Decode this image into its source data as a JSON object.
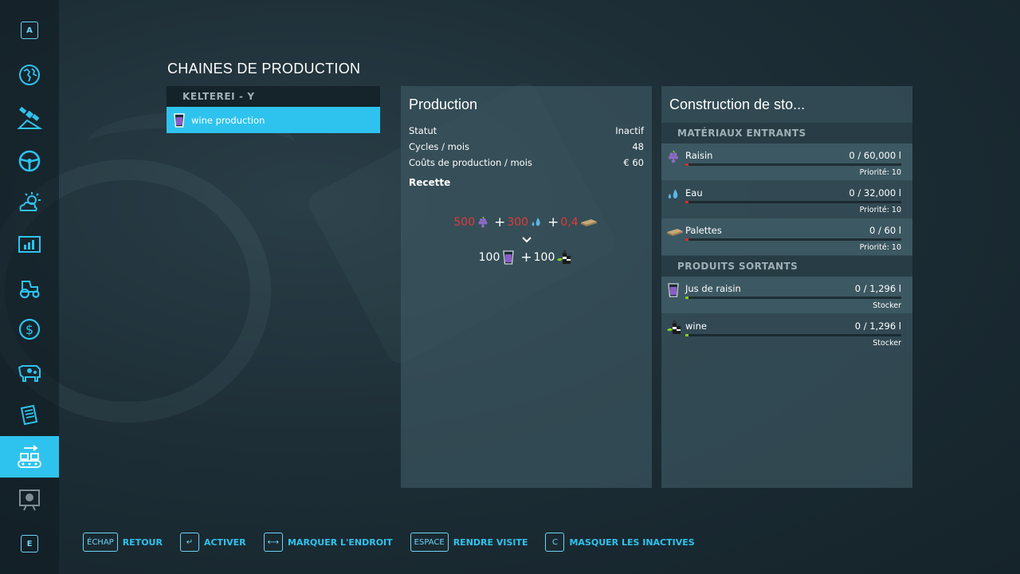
{
  "sidebar": {
    "top_key": "A",
    "bottom_key": "E",
    "items": [
      {
        "icon": "globe-icon"
      },
      {
        "icon": "satellite-icon"
      },
      {
        "icon": "steering-wheel-icon"
      },
      {
        "icon": "weather-icon"
      },
      {
        "icon": "statistics-icon"
      },
      {
        "icon": "tractor-icon"
      },
      {
        "icon": "money-icon"
      },
      {
        "icon": "cow-icon"
      },
      {
        "icon": "contracts-icon"
      },
      {
        "icon": "production-icon",
        "active": true
      },
      {
        "icon": "help-board-icon"
      }
    ]
  },
  "page_title": "CHAINES DE PRODUCTION",
  "production_list": {
    "header": "KELTEREI   - Y",
    "items": [
      {
        "label": "wine production",
        "selected": true
      }
    ]
  },
  "production_panel": {
    "title": "Production",
    "stats": [
      {
        "label": "Statut",
        "value": "Inactif"
      },
      {
        "label": "Cycles / mois",
        "value": "48"
      },
      {
        "label": "Coûts de production / mois",
        "value": "€ 60"
      }
    ],
    "recipe_label": "Recette",
    "inputs": [
      {
        "amount": "500",
        "icon": "grape-icon"
      },
      {
        "amount": "300",
        "icon": "water-drop-icon"
      },
      {
        "amount": "0,4",
        "icon": "pallet-icon"
      }
    ],
    "outputs": [
      {
        "amount": "100",
        "icon": "juice-icon"
      },
      {
        "amount": "100",
        "icon": "wine-icon"
      }
    ]
  },
  "storage_panel": {
    "title": "Construction de sto...",
    "inputs_header": "MATÉRIAUX ENTRANTS",
    "inputs": [
      {
        "name": "Raisin",
        "amount": "0  / 60,000 l",
        "sub": "Priorité: 10",
        "icon": "grape-icon",
        "fill_level": 0.0
      },
      {
        "name": "Eau",
        "amount": "0  / 32,000 l",
        "sub": "Priorité: 10",
        "icon": "water-drop-icon",
        "fill_level": 0.0
      },
      {
        "name": "Palettes",
        "amount": "0  / 60 l",
        "sub": "Priorité: 10",
        "icon": "pallet-icon",
        "fill_level": 0.0
      }
    ],
    "outputs_header": "PRODUITS SORTANTS",
    "outputs": [
      {
        "name": "Jus de raisin",
        "amount": "0  / 1,296 l",
        "sub": "Stocker",
        "icon": "juice-icon",
        "fill_level": 0.0
      },
      {
        "name": "wine",
        "amount": "0  / 1,296 l",
        "sub": "Stocker",
        "icon": "wine-icon",
        "fill_level": 0.0
      }
    ]
  },
  "colors": {
    "accent": "#2ec3ee",
    "input_bar": "#d82a2a",
    "output_bar": "#7ed321",
    "deficit_text": "#e23a3a"
  },
  "bottom_bar": [
    {
      "key": "ÉCHAP",
      "label": "RETOUR"
    },
    {
      "key": "↵",
      "label": "ACTIVER"
    },
    {
      "key": "⟷",
      "label": "MARQUER L'ENDROIT"
    },
    {
      "key": "ESPACE",
      "label": "RENDRE VISITE"
    },
    {
      "key": "C",
      "label": "MASQUER LES INACTIVES"
    }
  ]
}
